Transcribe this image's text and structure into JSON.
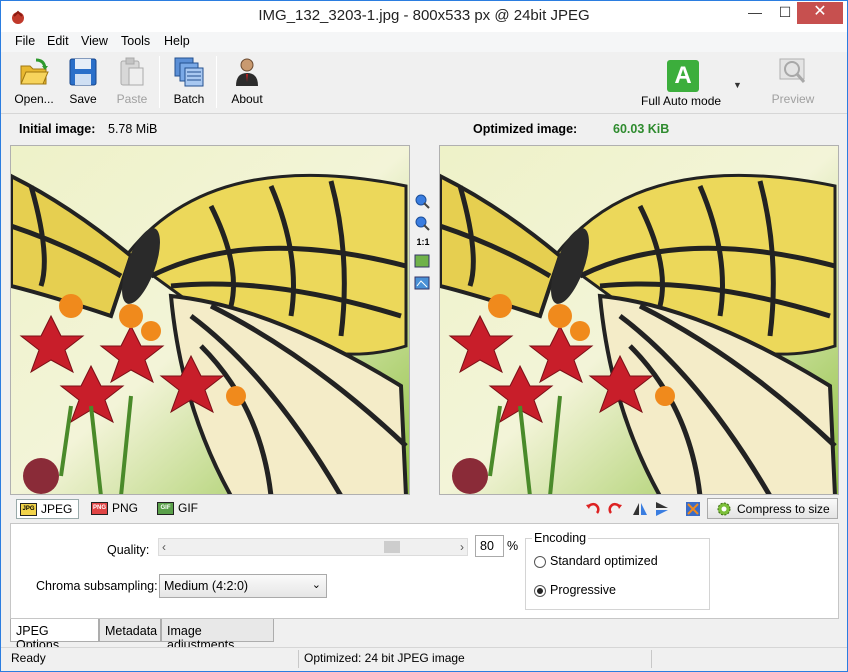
{
  "window": {
    "title": "IMG_132_3203-1.jpg - 800x533 px @ 24bit JPEG",
    "min": "—",
    "max": "☐",
    "close": "✕"
  },
  "menu": [
    "File",
    "Edit",
    "View",
    "Tools",
    "Help"
  ],
  "toolbar": {
    "open": "Open...",
    "save": "Save",
    "paste": "Paste",
    "batch": "Batch",
    "about": "About",
    "mode_letter": "A",
    "mode": "Full Auto mode",
    "preview": "Preview"
  },
  "info": {
    "initial_label": "Initial image:",
    "initial_value": "5.78 MiB",
    "optimized_label": "Optimized image:",
    "optimized_value": "60.03 KiB"
  },
  "zoom": {
    "one_to_one": "1:1"
  },
  "formats": {
    "tabs": [
      {
        "badge": "JPG",
        "label": "JPEG"
      },
      {
        "badge": "PNG",
        "label": "PNG"
      },
      {
        "badge": "GIF",
        "label": "GIF"
      }
    ],
    "compress": "Compress to size"
  },
  "options": {
    "quality_label": "Quality:",
    "quality_value": "80",
    "quality_fraction": 0.8,
    "percent": "%",
    "chroma_label": "Chroma subsampling:",
    "chroma_value": "Medium (4:2:0)",
    "encoding_title": "Encoding",
    "standard": "Standard optimized",
    "progressive": "Progressive",
    "selected_encoding": "Progressive"
  },
  "bottom_tabs": [
    "JPEG Options",
    "Metadata",
    "Image adjustments"
  ],
  "status": {
    "left": "Ready",
    "middle": "Optimized: 24 bit JPEG image"
  },
  "colors": {
    "accent_green": "#2e8b2e",
    "close_red": "#c7504f",
    "mode_green": "#3cae3c"
  }
}
